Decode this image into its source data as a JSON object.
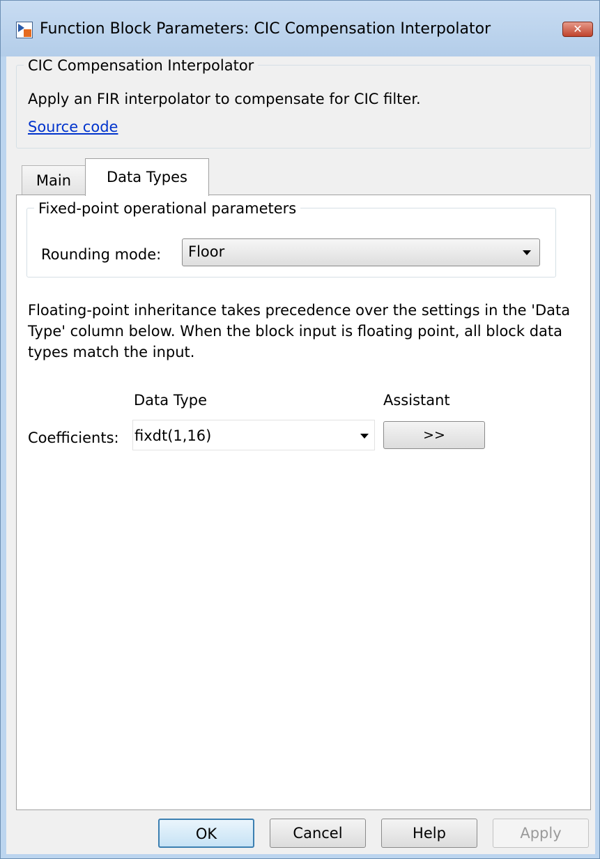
{
  "window": {
    "title": "Function Block Parameters: CIC Compensation Interpolator",
    "close_glyph": "✕"
  },
  "description": {
    "group_title": "CIC Compensation Interpolator",
    "text": "Apply an FIR interpolator to compensate for CIC filter.",
    "link": "Source code"
  },
  "tabs": [
    {
      "label": "Main",
      "active": false
    },
    {
      "label": "Data Types",
      "active": true
    }
  ],
  "fixed_point": {
    "group_title": "Fixed-point operational parameters",
    "rounding_label": "Rounding mode:",
    "rounding_value": "Floor"
  },
  "info_text": "Floating-point inheritance takes precedence over the settings in the 'Data Type' column below. When the block input is floating point, all block data types match the input.",
  "table": {
    "col_data_type": "Data Type",
    "col_assistant": "Assistant",
    "rows": [
      {
        "label": "Coefficients:",
        "value": "fixdt(1,16)",
        "assistant": ">>"
      }
    ]
  },
  "buttons": {
    "ok": "OK",
    "cancel": "Cancel",
    "help": "Help",
    "apply": "Apply"
  },
  "colors": {
    "window_frame": "#bcd5ef",
    "link": "#0033cc",
    "close_button": "#c0432c"
  },
  "icons": {
    "app": "simulink-block-icon",
    "close": "close-icon",
    "dropdown": "chevron-down-icon"
  }
}
